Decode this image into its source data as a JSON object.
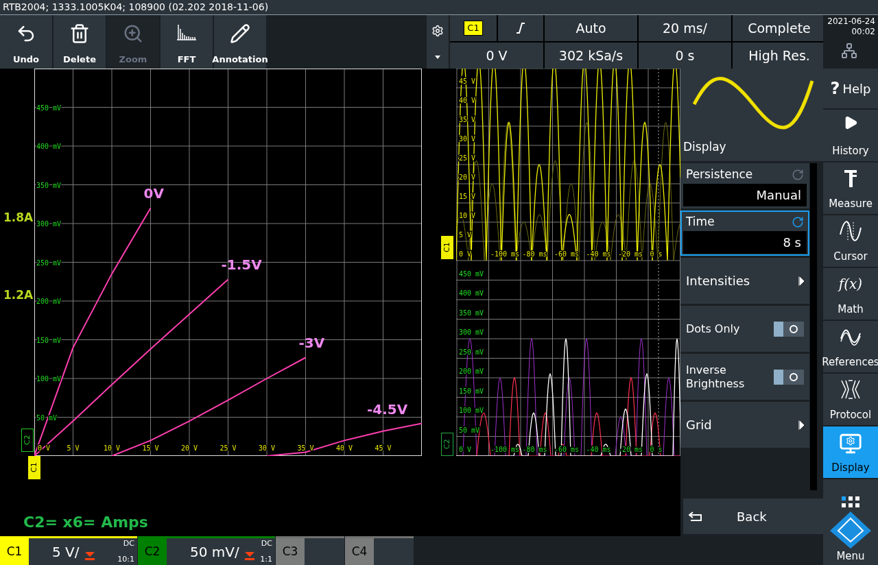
{
  "title_bar": {
    "text": "RTB2004; 1333.1005K04; 108900 (02.202 2018-11-06)"
  },
  "toolbar": [
    {
      "kind": "undo",
      "label": "Undo",
      "disabled": false
    },
    {
      "kind": "delete",
      "label": "Delete",
      "disabled": false
    },
    {
      "kind": "zoom",
      "label": "Zoom",
      "disabled": true
    },
    {
      "kind": "fft",
      "label": "FFT",
      "disabled": false
    },
    {
      "kind": "annotation",
      "label": "Annotation",
      "disabled": false
    }
  ],
  "settings": {
    "source": "C1",
    "row1": [
      "Auto",
      "20 ms/",
      "Complete"
    ],
    "row2": [
      "0 V",
      "302 kSa/s",
      "0 s",
      "High Res."
    ]
  },
  "clock": {
    "date": "2021-06-24",
    "time": "00:02"
  },
  "xy_plot": {
    "side_labels": [
      "1.8A",
      "1.2A"
    ],
    "x_marker": "C1",
    "y_marker": "C2",
    "chart_data": {
      "type": "line",
      "grid": true,
      "x": [
        0,
        5,
        10,
        15,
        20,
        25,
        30,
        35,
        40,
        45,
        50
      ],
      "xlim": [
        0,
        50
      ],
      "ylim": [
        0,
        500
      ],
      "xticks": [
        {
          "value": 0,
          "label": "0 V"
        },
        {
          "value": 5,
          "label": "5 V"
        },
        {
          "value": 10,
          "label": "10 V"
        },
        {
          "value": 15,
          "label": "15 V"
        },
        {
          "value": 20,
          "label": "20 V"
        },
        {
          "value": 25,
          "label": "25 V"
        },
        {
          "value": 30,
          "label": "30 V"
        },
        {
          "value": 35,
          "label": "35 V"
        },
        {
          "value": 40,
          "label": "40 V"
        },
        {
          "value": 45,
          "label": "45 V"
        }
      ],
      "yticks": [
        {
          "value": 50,
          "label": "50 mV"
        },
        {
          "value": 100,
          "label": "100 mV"
        },
        {
          "value": 150,
          "label": "150 mV"
        },
        {
          "value": 200,
          "label": "200 mV"
        },
        {
          "value": 250,
          "label": "250 mV"
        },
        {
          "value": 300,
          "label": "300 mV"
        },
        {
          "value": 350,
          "label": "350 mV"
        },
        {
          "value": 400,
          "label": "400 mV"
        },
        {
          "value": 450,
          "label": "450 mV"
        }
      ],
      "series": [
        {
          "name": "0V",
          "values": [
            0,
            140,
            235,
            320,
            null,
            null,
            null,
            null,
            null,
            null,
            null
          ]
        },
        {
          "name": "-1.5V",
          "values": [
            0,
            45,
            92,
            138,
            183,
            228,
            null,
            null,
            null,
            null,
            null
          ]
        },
        {
          "name": "-3V",
          "values": [
            null,
            null,
            0,
            20,
            45,
            72,
            100,
            127,
            null,
            null,
            null
          ]
        },
        {
          "name": "-4.5V",
          "values": [
            null,
            null,
            null,
            null,
            null,
            null,
            0,
            5,
            20,
            32,
            42
          ]
        }
      ]
    }
  },
  "note": "C2= x6= Amps",
  "voltage_plot": {
    "marker": "C1",
    "y_labels": [
      "45 V",
      "40 V",
      "35 V",
      "30 V",
      "25 V",
      "20 V",
      "15 V",
      "10 V",
      "5 V",
      "0 V"
    ],
    "x_labels": [
      "-100 ms",
      "-80 ms",
      "-60 ms",
      "-40 ms",
      "-20 ms",
      "0 s"
    ]
  },
  "current_plot": {
    "marker": "C2",
    "y_labels": [
      "450 mV",
      "400 mV",
      "350 mV",
      "300 mV",
      "250 mV",
      "200 mV",
      "150 mV",
      "100 mV",
      "50 mV",
      "0 V"
    ],
    "x_labels": [
      "-100 ms",
      "-80 ms",
      "-60 ms",
      "-40 ms",
      "-20 ms",
      "0 s"
    ]
  },
  "menu": {
    "title": "Display",
    "items": [
      {
        "kind": "field",
        "label": "Persistence",
        "value": "Manual",
        "selected": false
      },
      {
        "kind": "field",
        "label": "Time",
        "value": "8 s",
        "selected": true
      },
      {
        "kind": "submenu",
        "label": "Intensities"
      },
      {
        "kind": "toggle",
        "label": "Dots Only",
        "on": false
      },
      {
        "kind": "toggle",
        "label": "Inverse Brightness",
        "on": false
      },
      {
        "kind": "submenu",
        "label": "Grid"
      }
    ],
    "back": "Back"
  },
  "nav": [
    {
      "kind": "help",
      "glyph": "?",
      "label": "Help",
      "selected": false
    },
    {
      "kind": "history",
      "label": "History",
      "selected": false
    },
    {
      "kind": "measure",
      "label": "Measure",
      "selected": false
    },
    {
      "kind": "cursor",
      "label": "Cursor",
      "selected": false
    },
    {
      "kind": "math",
      "glyph": "f(x)",
      "label": "Math",
      "selected": false
    },
    {
      "kind": "references",
      "label": "References",
      "selected": false
    },
    {
      "kind": "protocol",
      "label": "Protocol",
      "selected": false
    },
    {
      "kind": "display",
      "label": "Display",
      "selected": true
    },
    {
      "kind": "menu",
      "label": "Menu",
      "selected": false
    }
  ],
  "channels": [
    {
      "name": "C1",
      "scale": "5 V/",
      "coupling": "DC",
      "probe": "10:1",
      "color": "#ffff00",
      "on": true
    },
    {
      "name": "C2",
      "scale": "50 mV/",
      "coupling": "DC",
      "probe": "1:1",
      "color": "#008000",
      "on": true
    },
    {
      "name": "C3",
      "color": "#808080",
      "on": false
    },
    {
      "name": "C4",
      "color": "#808080",
      "on": false
    }
  ]
}
